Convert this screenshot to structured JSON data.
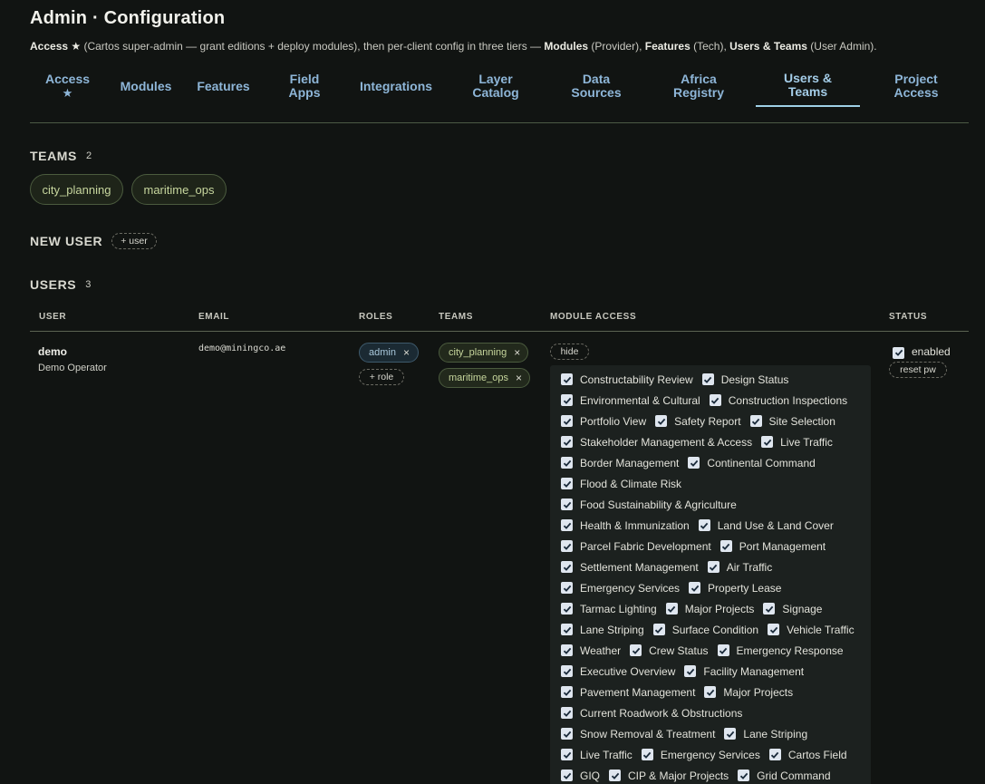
{
  "header": {
    "title": "Admin · Configuration",
    "subtitle": {
      "access": "Access ★",
      "part1": " (Cartos super-admin — grant editions + deploy modules), then per-client config in three tiers — ",
      "modules": "Modules",
      "part2": " (Provider), ",
      "features": "Features",
      "part3": " (Tech), ",
      "users_teams": "Users & Teams",
      "part4": " (User Admin)."
    }
  },
  "tabs": [
    {
      "line1": "Access",
      "line2": "★"
    },
    {
      "line1": "Modules",
      "line2": ""
    },
    {
      "line1": "Features",
      "line2": ""
    },
    {
      "line1": "Field",
      "line2": "Apps"
    },
    {
      "line1": "Integrations",
      "line2": ""
    },
    {
      "line1": "Layer",
      "line2": "Catalog"
    },
    {
      "line1": "Data",
      "line2": "Sources"
    },
    {
      "line1": "Africa",
      "line2": "Registry"
    },
    {
      "line1": "Users &",
      "line2": "Teams"
    },
    {
      "line1": "Project",
      "line2": "Access"
    }
  ],
  "active_tab": "Users & Teams",
  "teams": {
    "heading": "TEAMS",
    "count": "2",
    "items": [
      "city_planning",
      "maritime_ops"
    ]
  },
  "new_user": {
    "heading": "NEW USER",
    "button": "+ user"
  },
  "users": {
    "heading": "USERS",
    "count": "3",
    "columns": [
      "USER",
      "EMAIL",
      "ROLES",
      "TEAMS",
      "MODULE ACCESS",
      "STATUS"
    ],
    "rows": [
      {
        "name": "demo",
        "display_name": "Demo Operator",
        "email": "demo@miningco.ae",
        "roles": [
          "admin"
        ],
        "add_role": "+ role",
        "teams": [
          "city_planning",
          "maritime_ops"
        ],
        "module_toggle": "hide",
        "module_rows": [
          [
            "Constructability Review",
            "Design Status"
          ],
          [
            "Environmental & Cultural",
            "Construction Inspections"
          ],
          [
            "Portfolio View",
            "Safety Report",
            "Site Selection"
          ],
          [
            "Stakeholder Management & Access",
            "Live Traffic"
          ],
          [
            "Border Management",
            "Continental Command"
          ],
          [
            "Flood & Climate Risk"
          ],
          [
            "Food Sustainability & Agriculture"
          ],
          [
            "Health & Immunization",
            "Land Use & Land Cover"
          ],
          [
            "Parcel Fabric Development",
            "Port Management"
          ],
          [
            "Settlement Management",
            "Air Traffic"
          ],
          [
            "Emergency Services",
            "Property Lease"
          ],
          [
            "Tarmac Lighting",
            "Major Projects",
            "Signage"
          ],
          [
            "Lane Striping",
            "Surface Condition",
            "Vehicle Traffic"
          ],
          [
            "Weather",
            "Crew Status",
            "Emergency Response"
          ],
          [
            "Executive Overview",
            "Facility Management"
          ],
          [
            "Pavement Management",
            "Major Projects"
          ],
          [
            "Current Roadwork & Obstructions"
          ],
          [
            "Snow Removal & Treatment",
            "Lane Striping"
          ],
          [
            "Live Traffic",
            "Emergency Services",
            "Cartos Field"
          ],
          [
            "GIQ",
            "CIP & Major Projects",
            "Grid Command"
          ]
        ],
        "status_label": "enabled",
        "status_checked": true,
        "reset_button": "reset pw"
      }
    ]
  },
  "colors": {
    "background": "#111412",
    "tab_text": "#8eb6d8",
    "active_tab_underline": "#9fd0e6",
    "team_chip_text": "#c7d69e",
    "checkbox": "#dfe6ef"
  }
}
